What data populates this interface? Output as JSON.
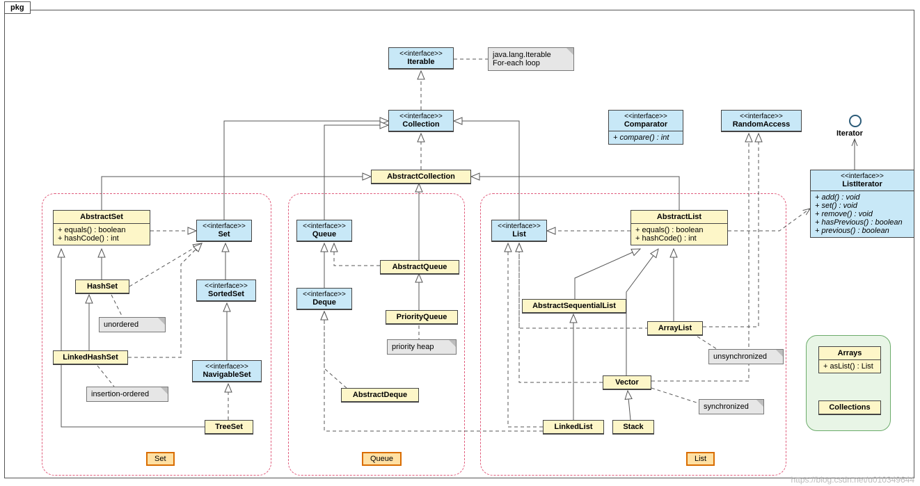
{
  "pkg_label": "pkg",
  "watermark": "https://blog.csdn.net/u010349644",
  "interfaces": {
    "st": "<<interface>>",
    "iterable": "Iterable",
    "collection": "Collection",
    "set": "Set",
    "sortedSet": "SortedSet",
    "navigableSet": "NavigableSet",
    "queue": "Queue",
    "deque": "Deque",
    "list": "List",
    "comparator": "Comparator",
    "randomAccess": "RandomAccess",
    "listIterator": "ListIterator"
  },
  "classes": {
    "abstractCollection": "AbstractCollection",
    "abstractSet": "AbstractSet",
    "hashSet": "HashSet",
    "linkedHashSet": "LinkedHashSet",
    "treeSet": "TreeSet",
    "abstractQueue": "AbstractQueue",
    "priorityQueue": "PriorityQueue",
    "abstractDeque": "AbstractDeque",
    "abstractList": "AbstractList",
    "abstractSequentialList": "AbstractSequentialList",
    "arrayList": "ArrayList",
    "vector": "Vector",
    "stack": "Stack",
    "linkedList": "LinkedList",
    "arrays": "Arrays",
    "collections": "Collections",
    "iterator": "Iterator"
  },
  "members": {
    "abstractSet": {
      "a": "+ equals() : boolean",
      "b": "+ hashCode() : int"
    },
    "abstractList": {
      "a": "+ equals() : boolean",
      "b": "+ hashCode() : int"
    },
    "comparator": {
      "a": "+ compare() : int"
    },
    "listIterator": {
      "a": "+ add() : void",
      "b": "+ set() : void",
      "c": "+ remove() : void",
      "d": "+ hasPrevious() : boolean",
      "e": "+ previous() : boolean"
    },
    "arrays": {
      "a": "+ asList() : List"
    }
  },
  "notes": {
    "iterable": {
      "a": "java.lang.Iterable",
      "b": "For-each loop"
    },
    "unordered": "unordered",
    "insertionOrdered": "insertion-ordered",
    "priorityHeap": "priority heap",
    "unsynchronized": "unsynchronized",
    "synchronized": "synchronized"
  },
  "tags": {
    "set": "Set",
    "queue": "Queue",
    "list": "List"
  }
}
